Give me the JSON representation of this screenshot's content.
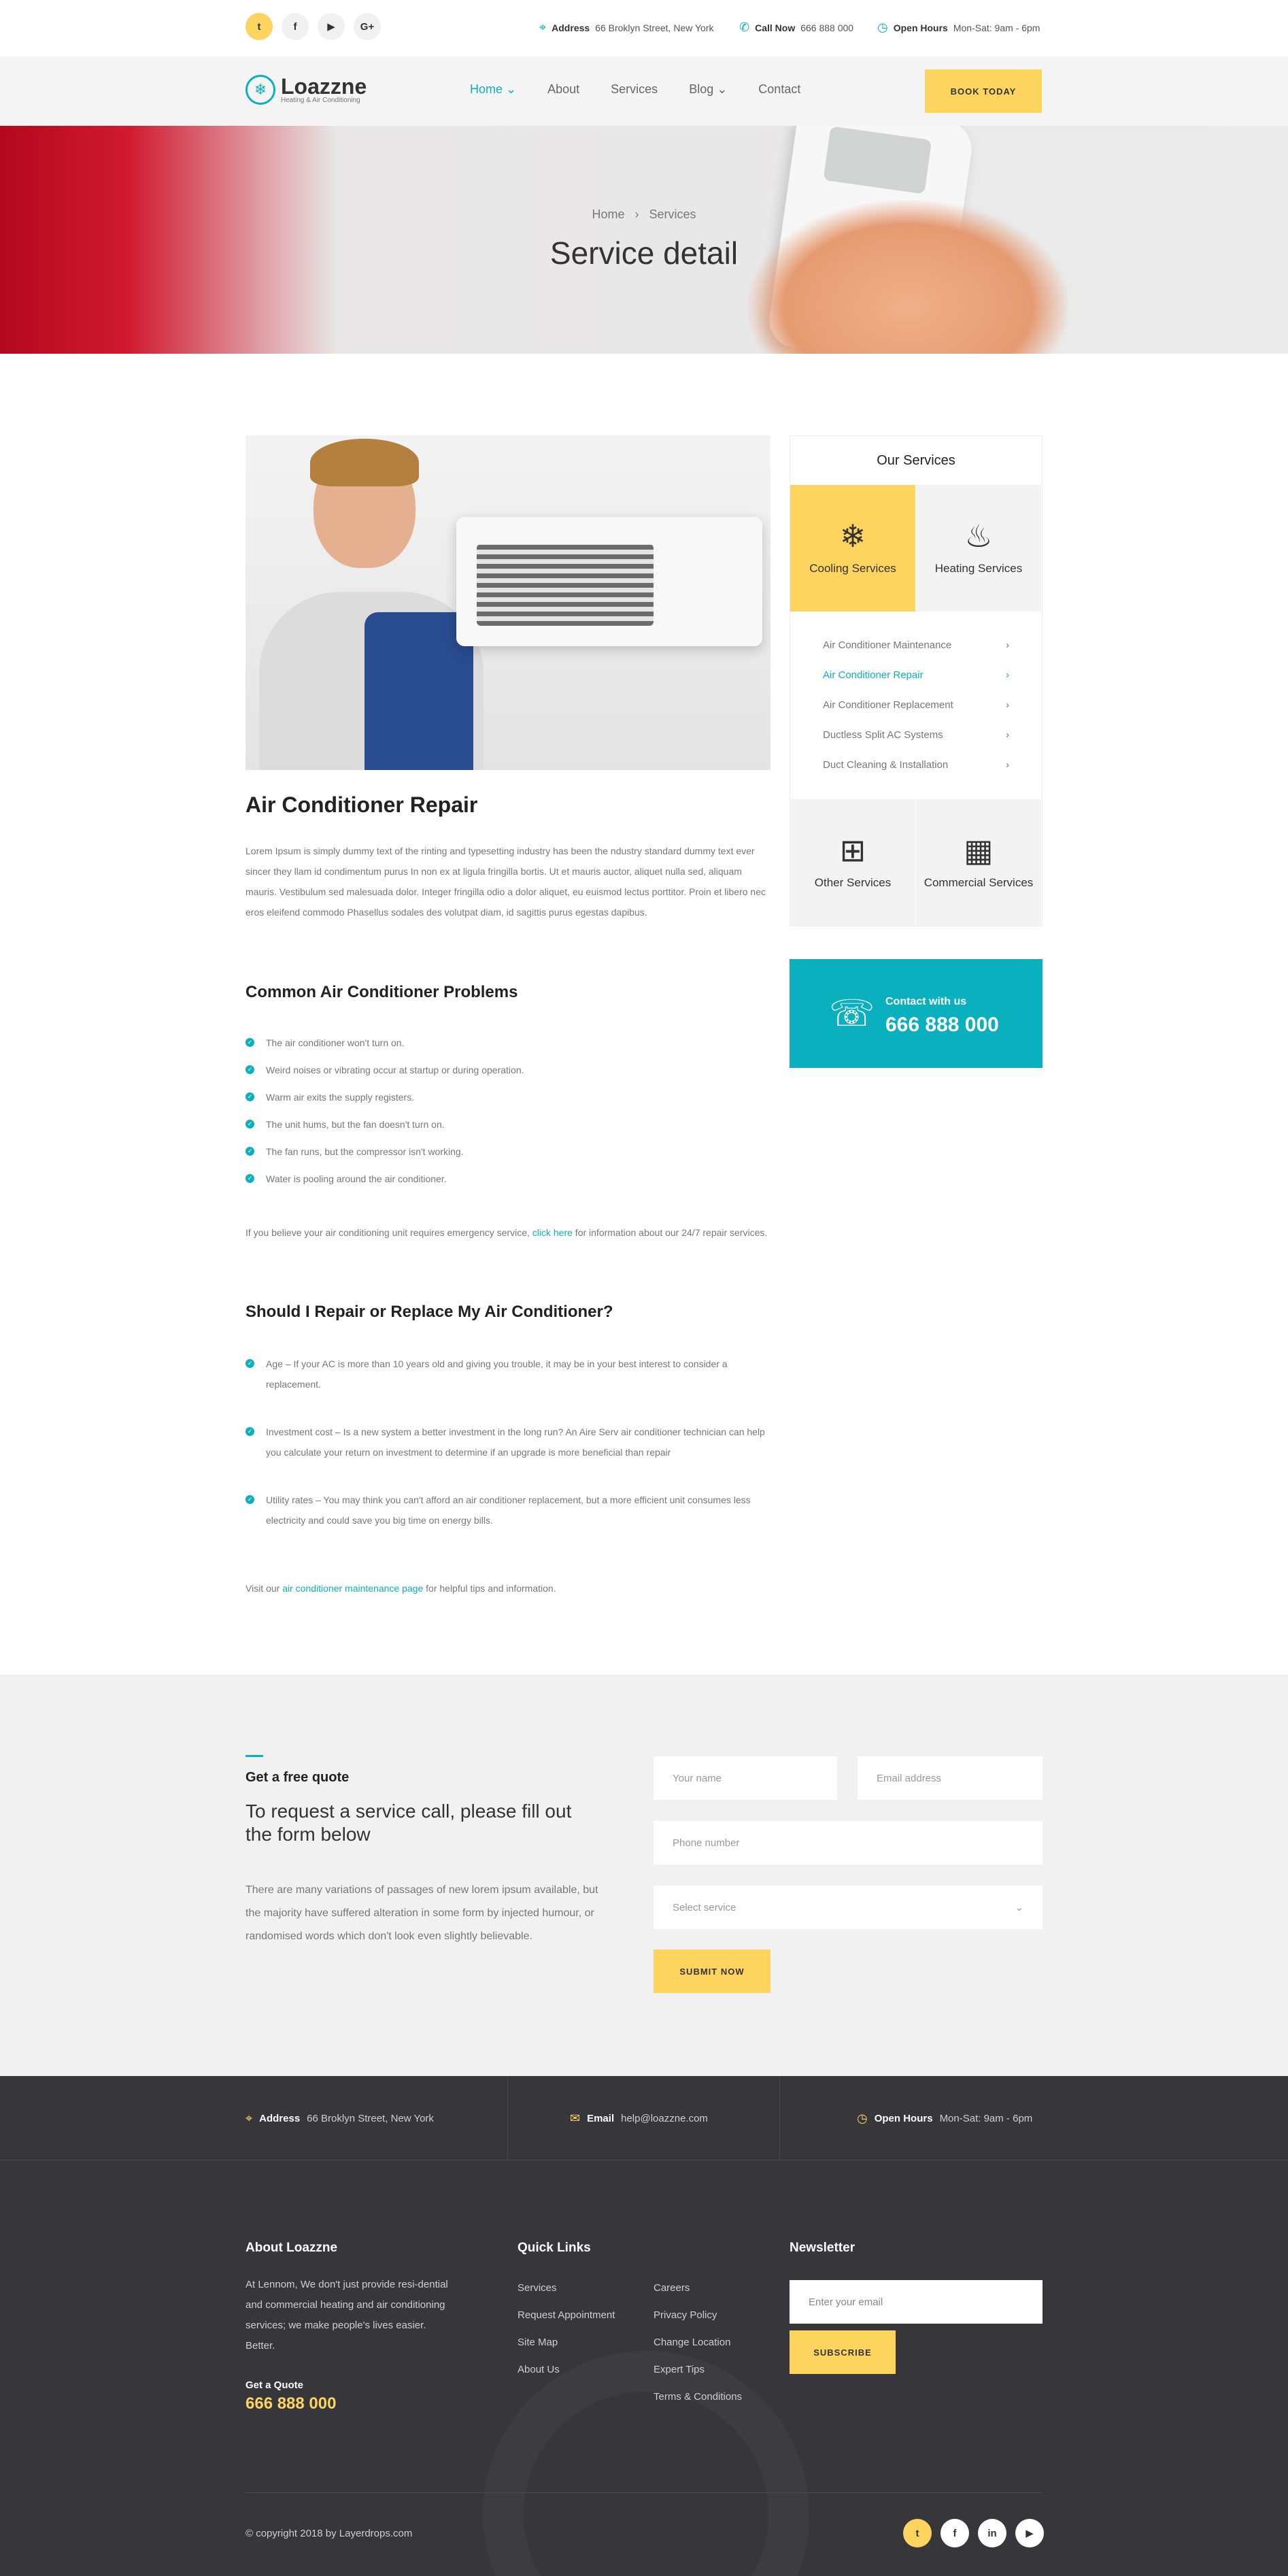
{
  "topbar": {
    "social": [
      "t",
      "f",
      "▶",
      "G+"
    ],
    "address_label": "Address",
    "address": "66 Broklyn Street, New York",
    "call_label": "Call Now",
    "call": "666 888 000",
    "hours_label": "Open Hours",
    "hours": "Mon-Sat: 9am - 6pm"
  },
  "nav": {
    "logo_name": "Loazzne",
    "logo_sub": "Heating & Air Conditioning",
    "items": [
      {
        "label": "Home ⌄"
      },
      {
        "label": "About"
      },
      {
        "label": "Services"
      },
      {
        "label": "Blog ⌄"
      },
      {
        "label": "Contact"
      }
    ],
    "cta": "BOOK TODAY"
  },
  "hero": {
    "breadcrumb_home": "Home",
    "breadcrumb_sep": "›",
    "breadcrumb_current": "Services",
    "title": "Service detail"
  },
  "article": {
    "title": "Air Conditioner Repair",
    "intro": "Lorem Ipsum is simply dummy text of the rinting and typesetting industry has been the ndustry standard dummy text ever sincer they llam id condimentum purus In non ex at ligula fringilla bortis. Ut et mauris auctor, aliquet nulla sed, aliquam mauris. Vestibulum sed malesuada dolor. Integer fringilla odio a dolor aliquet, eu euismod lectus porttitor. Proin et libero nec eros eleifend commodo Phasellus sodales des volutpat diam, id sagittis purus egestas dapibus.",
    "problems_title": "Common Air Conditioner Problems",
    "problems": [
      "The air conditioner won't turn on.",
      "Weird noises or vibrating occur at startup or during operation.",
      "Warm air exits the supply registers.",
      "The unit hums, but the fan doesn't turn on.",
      "The fan runs, but the compressor isn't working.",
      "Water is pooling around the air conditioner."
    ],
    "emergency_pre": "If you believe your air conditioning unit requires emergency service, ",
    "emergency_link": "click here",
    "emergency_post": " for information about our 24/7 repair services.",
    "repair_title": "Should I Repair or Replace My Air Conditioner?",
    "repair_points": [
      "Age – If your AC is more than 10 years old and giving you trouble, it may be in your best interest to consider a replacement.",
      "Investment cost – Is a new system a better investment in the long run? An Aire Serv air conditioner technician can help you calculate your return on investment to determine if an upgrade is more beneficial than repair",
      "Utility rates – You may think you can't afford an air conditioner replacement, but a more efficient unit consumes less electricity and could save you big time on energy bills."
    ],
    "visit_pre": "Visit our ",
    "visit_link": "air conditioner maintenance page",
    "visit_post": " for helpful tips and information."
  },
  "sidebar": {
    "title": "Our Services",
    "cards_top": [
      {
        "icon": "snowflake-icon",
        "label": "Cooling Services"
      },
      {
        "icon": "flame-icon",
        "label": "Heating Services"
      }
    ],
    "links": [
      {
        "label": "Air Conditioner Maintenance"
      },
      {
        "label": "Air Conditioner Repair"
      },
      {
        "label": "Air Conditioner Replacement"
      },
      {
        "label": "Ductless Split AC Systems"
      },
      {
        "label": "Duct Cleaning & Installation"
      }
    ],
    "chevron": "›",
    "cards_bottom": [
      {
        "icon": "fan-unit-icon",
        "label": "Other Services"
      },
      {
        "icon": "building-icon",
        "label": "Commercial Services"
      }
    ],
    "contact_label": "Contact with us",
    "contact_number": "666 888 000"
  },
  "quote": {
    "title": "Get a free quote",
    "subtitle": "To request a service call, please fill out the form below",
    "text": "There are many variations of passages of new lorem ipsum available, but the majority have suffered alteration in some form by injected humour, or randomised words which don't look even slightly believable.",
    "name_placeholder": "Your name",
    "email_placeholder": "Email address",
    "phone_placeholder": "Phone number",
    "service_placeholder": "Select service",
    "submit": "SUBMIT NOW"
  },
  "footer": {
    "address_label": "Address",
    "address": "66 Broklyn Street, New York",
    "email_label": "Email",
    "email": "help@loazzne.com",
    "hours_label": "Open Hours",
    "hours": "Mon-Sat: 9am - 6pm",
    "about_title": "About Loazzne",
    "about_text": "At Lennom, We don't just provide resi-dential and commercial heating and air conditioning services; we make people's lives easier. Better.",
    "quote_label": "Get a Quote",
    "quote_number": "666 888 000",
    "links_title": "Quick Links",
    "links_col1": [
      "Services",
      "Request Appointment",
      "Site Map",
      "About Us"
    ],
    "links_col2": [
      "Careers",
      "Privacy Policy",
      "Change Location",
      "Expert Tips",
      "Terms & Conditions"
    ],
    "newsletter_title": "Newsletter",
    "newsletter_placeholder": "Enter your email",
    "subscribe": "SUBSCRIBE",
    "copyright": "© copyright 2018 by Layerdrops.com",
    "social": [
      "t",
      "f",
      "in",
      "▶"
    ]
  }
}
